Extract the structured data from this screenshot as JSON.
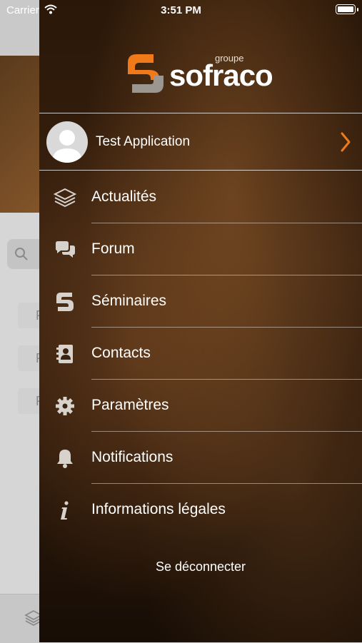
{
  "status_bar": {
    "carrier": "Carrier",
    "time": "3:51 PM"
  },
  "background": {
    "rows": [
      "F",
      "F",
      "F"
    ]
  },
  "logo": {
    "groupe": "groupe",
    "brand": "sofraco"
  },
  "profile": {
    "name": "Test Application"
  },
  "menu": [
    {
      "label": "Actualités",
      "icon": "layers-icon"
    },
    {
      "label": "Forum",
      "icon": "chat-bubbles-icon"
    },
    {
      "label": "Séminaires",
      "icon": "sofraco-s-icon"
    },
    {
      "label": "Contacts",
      "icon": "contact-book-icon"
    },
    {
      "label": "Paramètres",
      "icon": "gear-icon"
    },
    {
      "label": "Notifications",
      "icon": "bell-icon"
    },
    {
      "label": "Informations légales",
      "icon": "info-icon"
    }
  ],
  "logout_label": "Se déconnecter",
  "colors": {
    "accent": "#f07a1a",
    "drawer_bg": "#2a1708",
    "text": "#ffffff"
  }
}
